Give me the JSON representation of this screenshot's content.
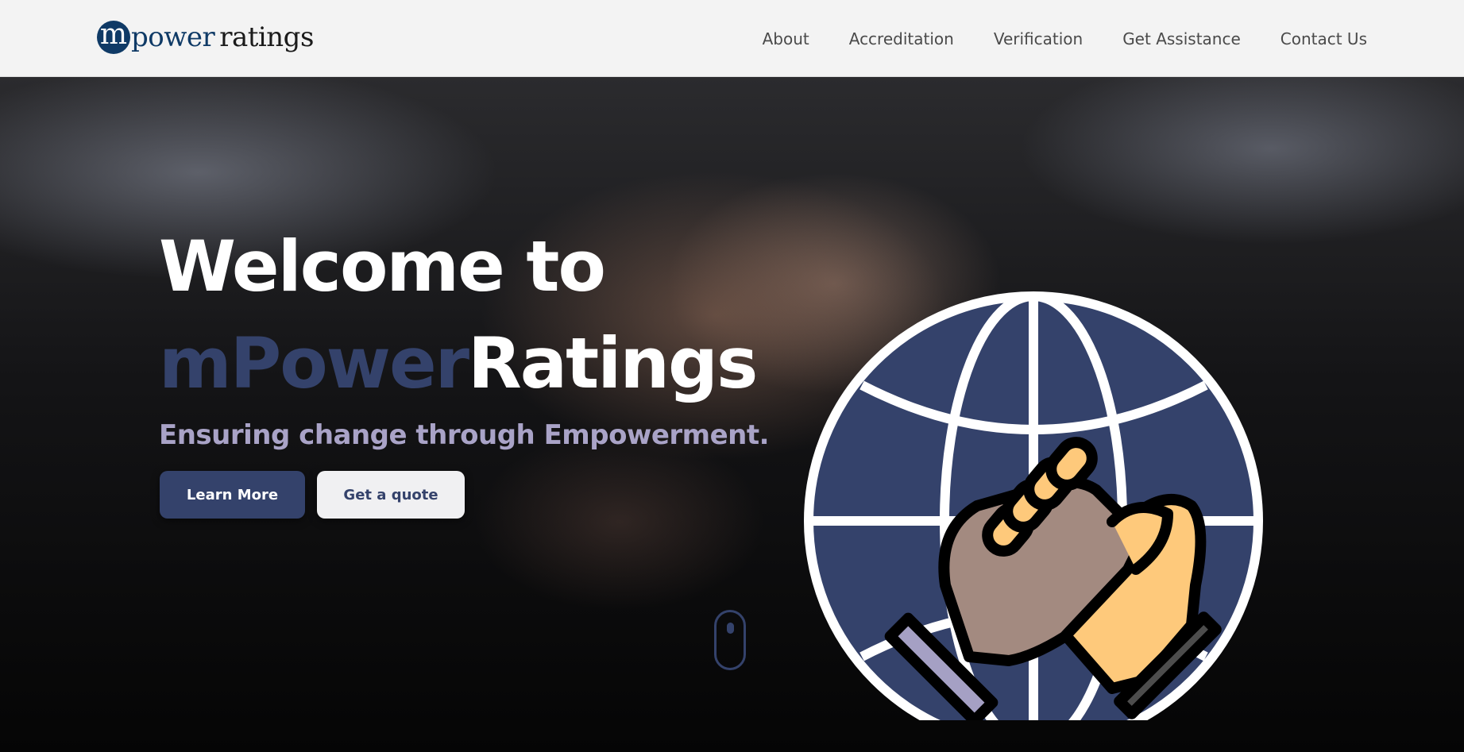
{
  "header": {
    "logo": {
      "mark": "m",
      "part1": "power",
      "part2": "ratings"
    },
    "nav": [
      {
        "label": "About"
      },
      {
        "label": "Accreditation"
      },
      {
        "label": "Verification"
      },
      {
        "label": "Get Assistance"
      },
      {
        "label": "Contact Us"
      }
    ]
  },
  "hero": {
    "title_line1": "Welcome to",
    "title_accent": "mPower",
    "title_rest": "Ratings",
    "tagline": "Ensuring change through Empowerment.",
    "primary_button": "Learn More",
    "secondary_button": "Get a quote",
    "illustration": "globe-handshake-icon"
  },
  "colors": {
    "brand_navy": "#34426b",
    "logo_blue": "#0f3a66",
    "nav_bg": "#f3f3f3",
    "tagline": "#a9a3c7",
    "skin_dark": "#a38a80",
    "skin_light": "#fec97b",
    "cuff_light": "#a5a0c4",
    "cuff_dark": "#4d4d4d"
  }
}
